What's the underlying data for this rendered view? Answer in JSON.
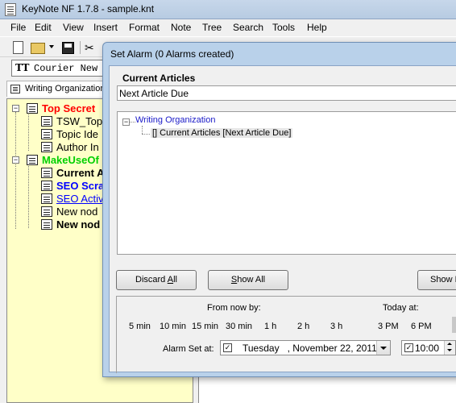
{
  "app": {
    "title": "KeyNote NF  1.7.8 - sample.knt"
  },
  "menu": [
    "File",
    "Edit",
    "View",
    "Insert",
    "Format",
    "Note",
    "Tree",
    "Search",
    "Tools",
    "Help"
  ],
  "toolbar": {
    "icons": [
      "new-file-icon",
      "open-folder-icon",
      "dropdown-arrow-icon",
      "save-icon",
      "cut-icon"
    ]
  },
  "fontbar": {
    "font_icon": "TT",
    "font_name": "Courier New"
  },
  "tabs": [
    {
      "label": "Writing Organization"
    }
  ],
  "tree": {
    "nodes": [
      {
        "label": "Top Secret",
        "color": "#ff0000",
        "bold": true,
        "level": 0,
        "expander": "−"
      },
      {
        "label": "TSW_Top",
        "color": "#000000",
        "bold": false,
        "level": 1
      },
      {
        "label": "Topic Ide",
        "color": "#000000",
        "bold": false,
        "level": 1
      },
      {
        "label": "Author In",
        "color": "#000000",
        "bold": false,
        "level": 1
      },
      {
        "label": "MakeUseOf",
        "color": "#00d000",
        "bold": true,
        "level": 0,
        "expander": "−"
      },
      {
        "label": "Current A",
        "color": "#000000",
        "bold": true,
        "level": 1
      },
      {
        "label": "SEO Scra",
        "color": "#0000ff",
        "bold": true,
        "level": 1
      },
      {
        "label": "SEO Activ",
        "color": "#0000ff",
        "bold": false,
        "underline": true,
        "level": 1
      },
      {
        "label": "New nod",
        "color": "#000000",
        "bold": false,
        "level": 1
      },
      {
        "label": "New nod",
        "color": "#000000",
        "bold": true,
        "level": 1
      }
    ]
  },
  "dialog": {
    "title": "Set Alarm  (0 Alarms created)",
    "heading": "Current Articles",
    "subject_value": "Next Article Due",
    "alarm_tree": {
      "root_expander": "−",
      "root_label": "Writing Organization",
      "child_label": "[] Current Articles [Next Article Due]"
    },
    "buttons": {
      "discard_all": "Discard All",
      "show_all": "Show All",
      "show_r": "Show R"
    },
    "from_now_by_label": "From now by:",
    "today_at_label": "Today at:",
    "from_now_options": [
      "5 min",
      "10 min",
      "15 min",
      "30 min",
      "1 h",
      "2 h",
      "3 h"
    ],
    "today_at_options": [
      "3 PM",
      "6 PM"
    ],
    "alarm_set_at_label": "Alarm Set at:",
    "date_value": "Tuesday   , November 22, 2011",
    "date_checked": "✓",
    "time_value": "10:00",
    "time_checked": "✓"
  }
}
